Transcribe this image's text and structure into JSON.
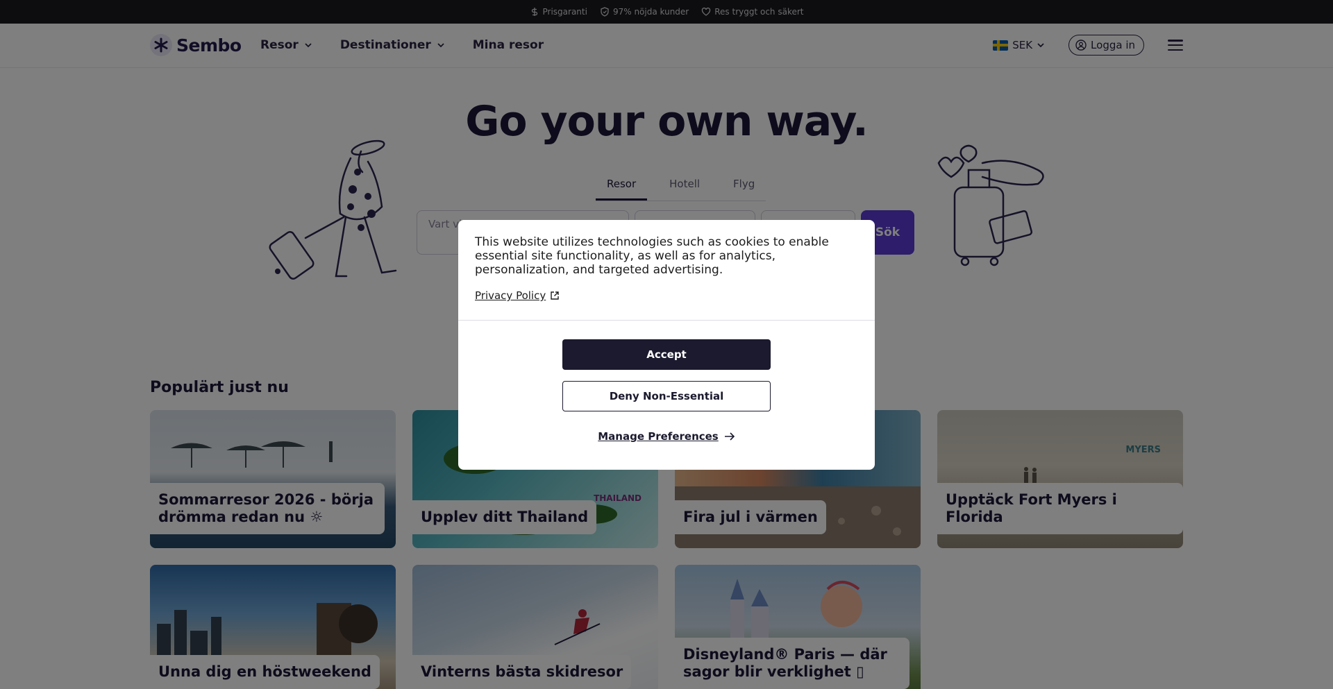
{
  "topbar": {
    "usps": [
      {
        "icon": "dollar-icon",
        "label": "Prisgaranti"
      },
      {
        "icon": "shield-icon",
        "label": "97% nöjda kunder"
      },
      {
        "icon": "heart-icon",
        "label": "Res tryggt och säkert"
      }
    ]
  },
  "header": {
    "logo": "Sembo",
    "nav": [
      "Resor",
      "Destinationer",
      "Mina resor"
    ],
    "currency": "SEK",
    "login": "Logga in"
  },
  "hero": {
    "title": "Go your own way.",
    "tabs": [
      "Resor",
      "Hotell",
      "Flyg"
    ],
    "active_tab": "Resor",
    "search_placeholder": "Vart vi",
    "search_button": "Sök"
  },
  "popular": {
    "title": "Populärt just nu",
    "cards": [
      {
        "title": "Sommarresor 2026 - börja drömma redan nu ☼"
      },
      {
        "title": "Upplev ditt Thailand",
        "badge": "THAILAND"
      },
      {
        "title": "Fira jul i värmen"
      },
      {
        "title": "Upptäck Fort Myers i Florida",
        "badge": "MYERS"
      },
      {
        "title": "Unna dig en höstweekend"
      },
      {
        "title": "Vinterns bästa skidresor"
      },
      {
        "title": "Disneyland® Paris — där sagor blir verklighet ▯"
      }
    ]
  },
  "cookie_modal": {
    "message": "This website utilizes technologies such as cookies to enable essential site functionality, as well as for analytics, personalization, and targeted advertising.",
    "privacy_link": "Privacy Policy",
    "accept": "Accept",
    "deny": "Deny Non-Essential",
    "manage": "Manage Preferences"
  },
  "colors": {
    "brand_purple": "#5a3ad4",
    "dark": "#1b1a2e",
    "topbar": "#1b1b1f"
  }
}
